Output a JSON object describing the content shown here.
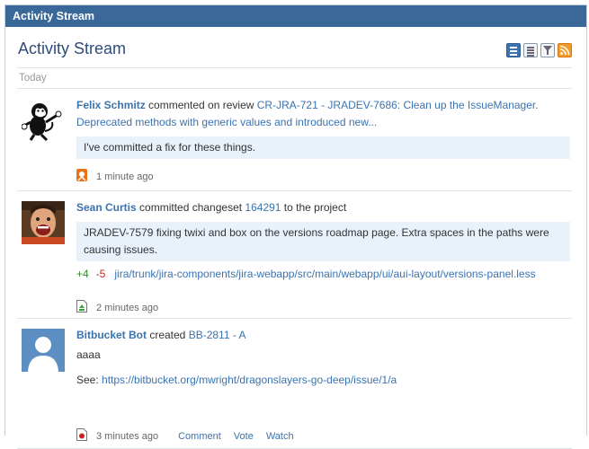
{
  "gadget": {
    "header_title": "Activity Stream"
  },
  "stream": {
    "title": "Activity Stream",
    "day_label": "Today",
    "view_icons": [
      "list-view-icon",
      "full-view-icon",
      "filter-icon",
      "rss-feed-icon"
    ]
  },
  "entries": [
    {
      "author": "Felix Schmitz",
      "verb": " commented on review ",
      "target": "CR-JRA-721 - JRADEV-7686: Clean up the IssueManager. Deprecated methods with generic values and introduced new...",
      "quote": "I've committed a fix for these things.",
      "timestamp": "1 minute ago",
      "type_icon": "review-icon"
    },
    {
      "author": "Sean Curtis",
      "verb": " committed changeset ",
      "target": "164291",
      "suffix": " to the project",
      "quote": "JRADEV-7579 fixing twixi and box on the versions roadmap page. Extra spaces in the paths were causing issues.",
      "additions": "+4",
      "deletions": "-5",
      "file_path": "jira/trunk/jira-components/jira-webapp/src/main/webapp/ui/aui-layout/versions-panel.less",
      "timestamp": "2 minutes ago",
      "type_icon": "changeset-icon"
    },
    {
      "author": "Bitbucket Bot",
      "verb": " created ",
      "target": "BB-2811 - A",
      "body": "aaaa",
      "see_label": "See: ",
      "see_link": "https://bitbucket.org/mwright/dragonslayers-go-deep/issue/1/a",
      "timestamp": "3 minutes ago",
      "actions": {
        "comment": "Comment",
        "vote": "Vote",
        "watch": "Watch"
      },
      "type_icon": "issue-icon"
    }
  ],
  "colors": {
    "header_bg": "#3a6899",
    "link": "#3b73af",
    "quote_bg": "#e9f1fb",
    "additions": "#2f8a2f",
    "deletions": "#cc2222"
  }
}
